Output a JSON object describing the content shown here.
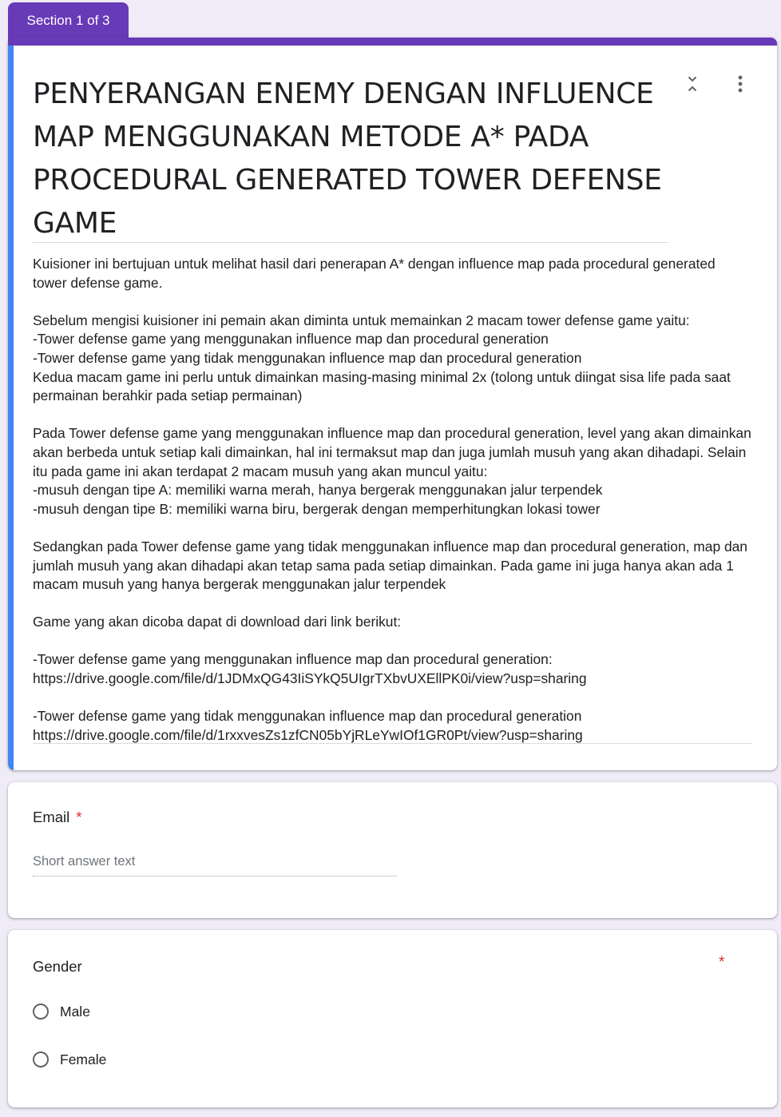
{
  "section_tab": {
    "label": "Section 1 of 3"
  },
  "title_card": {
    "title": "PENYERANGAN ENEMY DENGAN INFLUENCE MAP MENGGUNAKAN METODE A* PADA PROCEDURAL GENERATED TOWER DEFENSE GAME",
    "description": "Kuisioner ini bertujuan untuk melihat hasil dari penerapan A* dengan influence map pada procedural generated tower defense game.\n\nSebelum mengisi kuisioner ini pemain akan diminta untuk memainkan 2 macam tower defense game yaitu:\n-Tower defense game yang menggunakan influence map dan procedural generation\n-Tower defense game yang tidak menggunakan influence map dan procedural generation\nKedua macam game ini perlu untuk dimainkan masing-masing minimal 2x (tolong untuk diingat sisa life pada saat permainan berahkir pada setiap permainan)\n\nPada Tower defense game yang menggunakan influence map dan procedural generation, level yang akan dimainkan akan berbeda untuk setiap kali dimainkan, hal ini termaksut map dan juga jumlah musuh yang akan dihadapi. Selain itu pada game ini akan terdapat 2 macam musuh yang akan muncul yaitu:\n-musuh dengan tipe A: memiliki warna merah, hanya bergerak menggunakan jalur terpendek\n-musuh dengan tipe B: memiliki warna biru, bergerak dengan memperhitungkan lokasi tower\n\nSedangkan pada Tower defense game yang tidak menggunakan influence map dan procedural generation, map dan jumlah musuh yang akan dihadapi akan tetap sama pada setiap dimainkan. Pada game ini juga hanya akan ada 1 macam musuh yang hanya bergerak menggunakan jalur terpendek\n\nGame yang akan dicoba dapat di download dari link berikut:\n\n-Tower defense game yang menggunakan influence map dan procedural generation:\nhttps://drive.google.com/file/d/1JDMxQG43IiSYkQ5UIgrTXbvUXEllPK0i/view?usp=sharing\n\n-Tower defense game yang tidak menggunakan influence map dan procedural generation\nhttps://drive.google.com/file/d/1rxxvesZs1zfCN05bYjRLeYwIOf1GR0Pt/view?usp=sharing",
    "collapse_icon": "collapse-icon",
    "more_icon": "more-vert-icon"
  },
  "email_question": {
    "label": "Email",
    "required_mark": "*",
    "placeholder": "Short answer text"
  },
  "gender_question": {
    "label": "Gender",
    "required_mark": "*",
    "options": [
      {
        "label": "Male"
      },
      {
        "label": "Female"
      }
    ]
  },
  "colors": {
    "accent": "#673ab7",
    "focus_bar": "#4285f4",
    "required": "#d93025",
    "background": "#efebf7"
  }
}
